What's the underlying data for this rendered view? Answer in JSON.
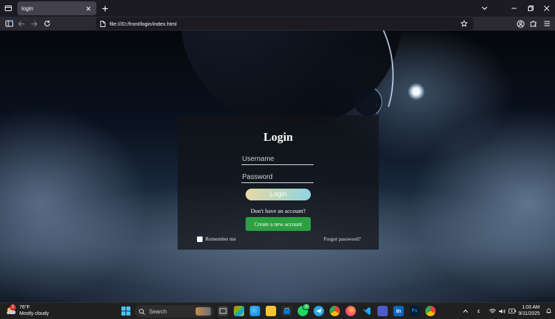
{
  "browser": {
    "tab_title": "login",
    "url": "file:///D:/front/login/index.html"
  },
  "login": {
    "title": "Login",
    "username_placeholder": "Username",
    "password_placeholder": "Password",
    "login_button": "Login",
    "no_account_text": "Don't have an account?",
    "create_button": "Create a new account",
    "remember_label": "Remember me",
    "forgot_link": "Forgot password?"
  },
  "taskbar": {
    "weather_temp": "76°F",
    "weather_condition": "Mostly cloudy",
    "weather_badge": "2",
    "search_label": "Search",
    "whatsapp_badge": "2",
    "tray_language": "ε",
    "clock_time": "1:03 AM",
    "clock_date": "9/11/2025"
  },
  "colors": {
    "card_background": "#121418",
    "create_button": "#2ea043",
    "taskbar": "#202020",
    "browser_chrome": "#2b2a33"
  }
}
